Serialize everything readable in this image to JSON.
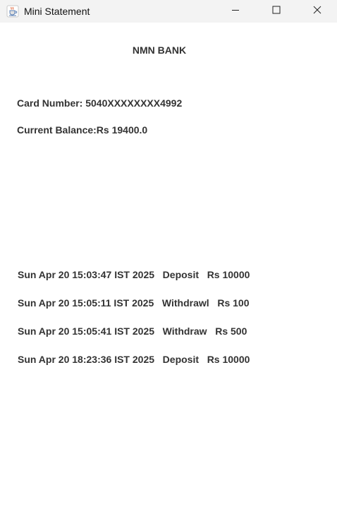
{
  "window": {
    "title": "Mini Statement",
    "icon": "java-cup-icon"
  },
  "bank": {
    "name": "NMN BANK"
  },
  "account": {
    "card_number": "Card Number: 5040XXXXXXXX4992",
    "current_balance": "Current Balance:Rs 19400.0"
  },
  "transactions": [
    "Sun Apr 20 15:03:47 IST 2025   Deposit   Rs 10000",
    "Sun Apr 20 15:05:11 IST 2025   Withdrawl   Rs 100",
    "Sun Apr 20 15:05:41 IST 2025   Withdraw   Rs 500",
    "Sun Apr 20 18:23:36 IST 2025   Deposit   Rs 10000"
  ],
  "colors": {
    "titlebar_bg": "#f3f3f3",
    "text": "#333333",
    "background": "#ffffff"
  }
}
